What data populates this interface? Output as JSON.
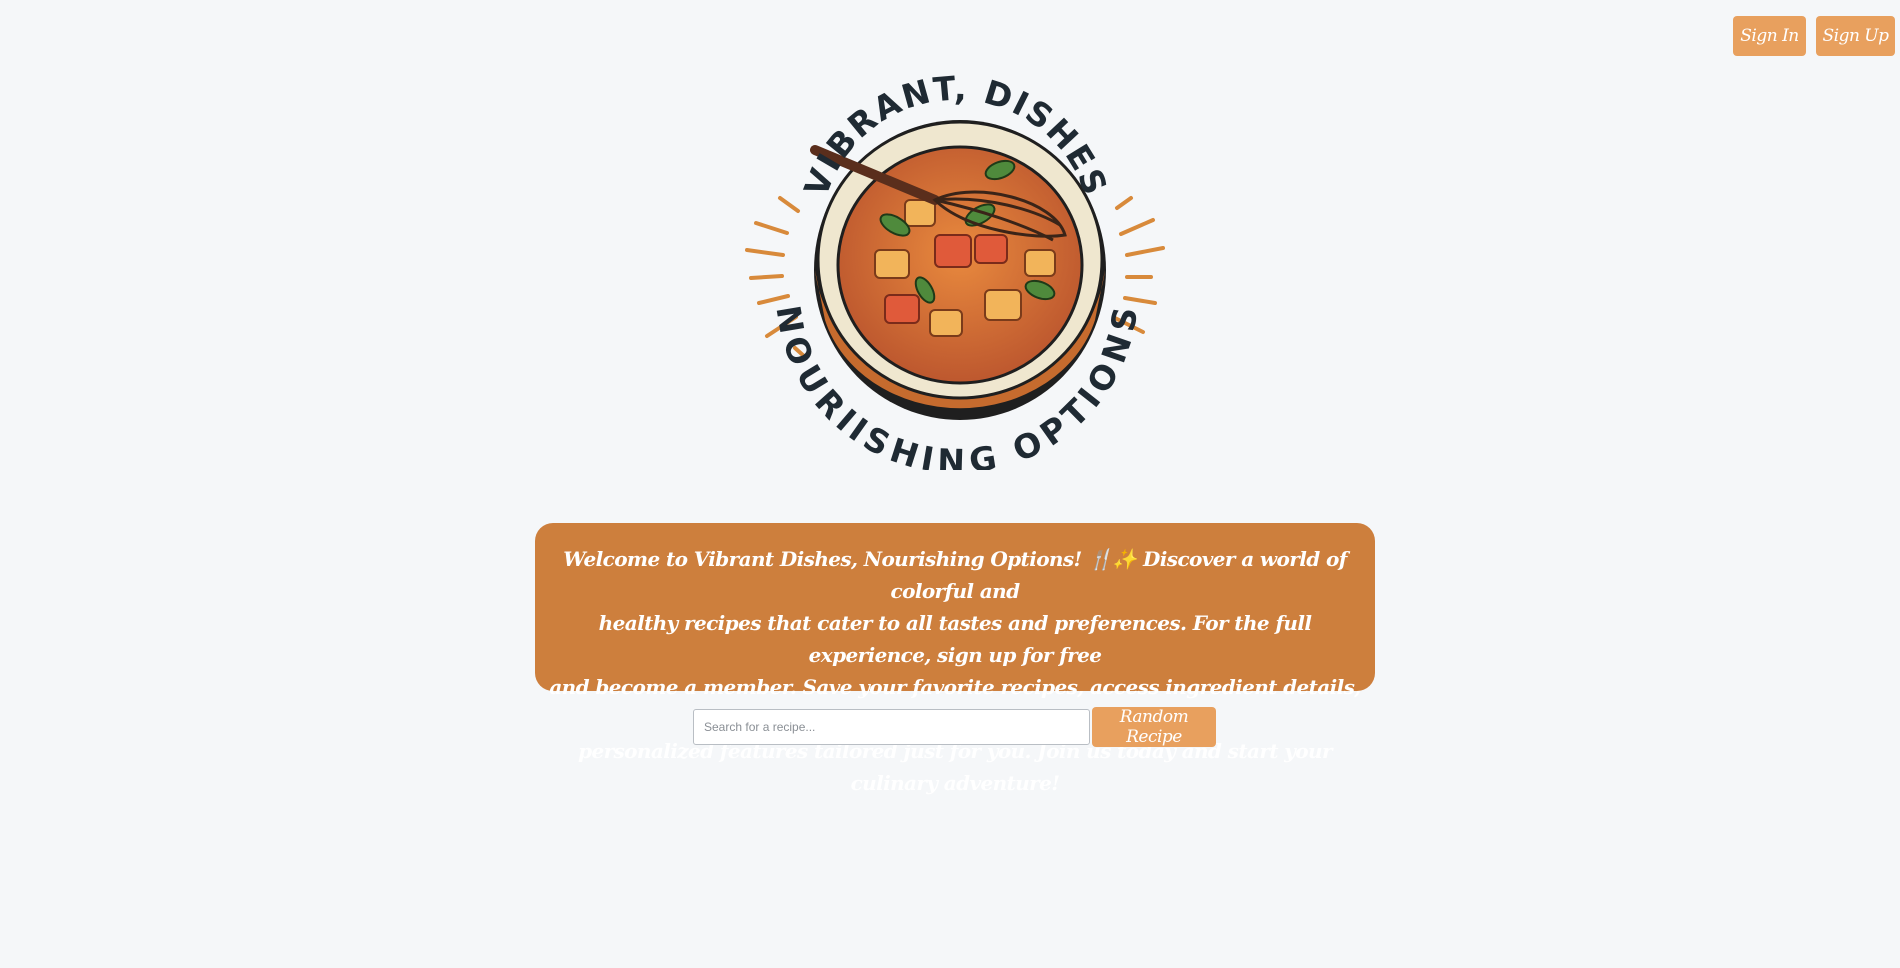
{
  "header": {
    "sign_in_label": "Sign In",
    "sign_up_label": "Sign Up"
  },
  "logo": {
    "top_text": "VIBRANT, DISHES",
    "bottom_text": "NOURIISHING OPTIONS"
  },
  "welcome": {
    "lines": [
      "Welcome to Vibrant Dishes, Nourishing Options! 🍴✨ Discover a world of colorful and",
      "healthy recipes that cater to all tastes and preferences. For the full experience, sign up for free",
      "and become a member. Save your favorite recipes, access ingredient details, and enjoy",
      "personalized features tailored just for you. Join us today and start your culinary adventure!"
    ]
  },
  "search": {
    "placeholder": "Search for a recipe...",
    "value": ""
  },
  "random_label": "Random Recipe",
  "colors": {
    "accent": "#e8a05e",
    "banner": "#cd7f3d",
    "background": "#f5f7f9"
  }
}
